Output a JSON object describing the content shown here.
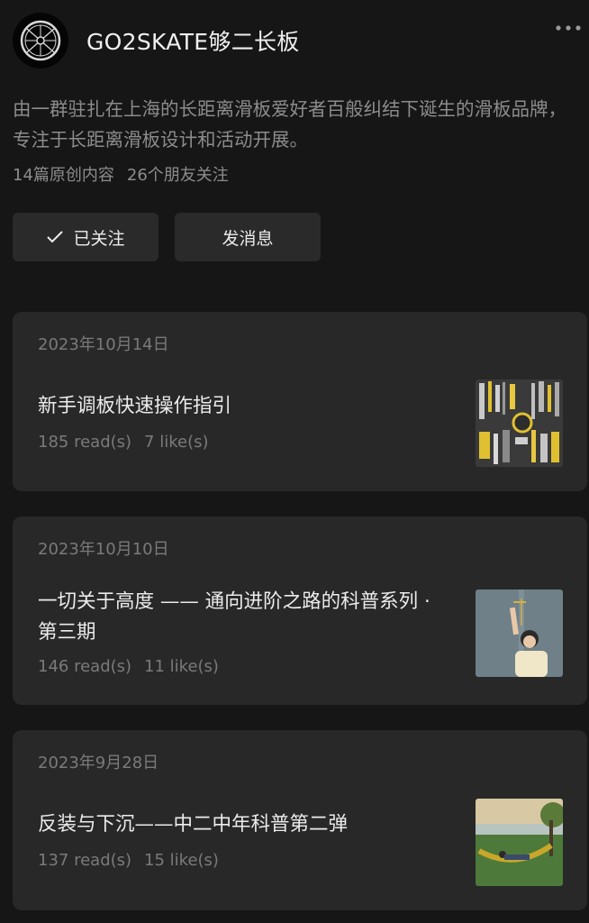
{
  "profile": {
    "name": "GO2SKATE够二长板",
    "description": "由一群驻扎在上海的长距离滑板爱好者百般纠结下诞生的滑板品牌，专注于长距离滑板设计和活动开展。",
    "original_count": "14篇原创内容",
    "friends_following": "26个朋友关注"
  },
  "actions": {
    "follow_label": "已关注",
    "message_label": "发消息"
  },
  "articles": [
    {
      "date": "2023年10月14日",
      "title": "新手调板快速操作指引",
      "reads": "185 read(s)",
      "likes": "7 like(s)",
      "thumbnail": "tools-image"
    },
    {
      "date": "2023年10月10日",
      "title": "一切关于高度 —— 通向进阶之路的科普系列 · 第三期",
      "reads": "146 read(s)",
      "likes": "11 like(s)",
      "thumbnail": "height-measure-image"
    },
    {
      "date": "2023年9月28日",
      "title": "反装与下沉——中二中年科普第二弹",
      "reads": "137 read(s)",
      "likes": "15 like(s)",
      "thumbnail": "hammock-image"
    }
  ],
  "icons": {
    "more": "more-dots-icon",
    "check": "check-icon"
  },
  "colors": {
    "background": "#161616",
    "card": "#282828",
    "button": "#2a2a2a",
    "muted_text": "#8c8c8c"
  }
}
